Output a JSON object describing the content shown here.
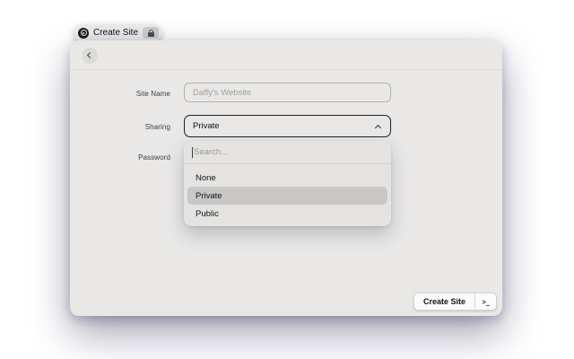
{
  "tab": {
    "title": "Create Site"
  },
  "window": {
    "form": {
      "site_name": {
        "label": "Site Name",
        "placeholder": "Daffy's Website",
        "value": ""
      },
      "sharing": {
        "label": "Sharing",
        "value": "Private"
      },
      "password": {
        "label": "Password"
      },
      "dropdown": {
        "search_placeholder": "Search...",
        "options": [
          "None",
          "Private",
          "Public"
        ],
        "selected": "Private"
      }
    },
    "footer": {
      "create_button": "Create Site",
      "terminal_button": ">_"
    }
  },
  "colors": {
    "window_bg": "#e9e8e7",
    "selected_option_bg": "#c9c8c6",
    "select_border": "#1d1d1d",
    "backdrop_top_left": "#5ae6f6",
    "backdrop_top_right": "#3d41d8",
    "backdrop_mid_left": "#d9abe9",
    "backdrop_bottom": "#8a6ee7"
  }
}
